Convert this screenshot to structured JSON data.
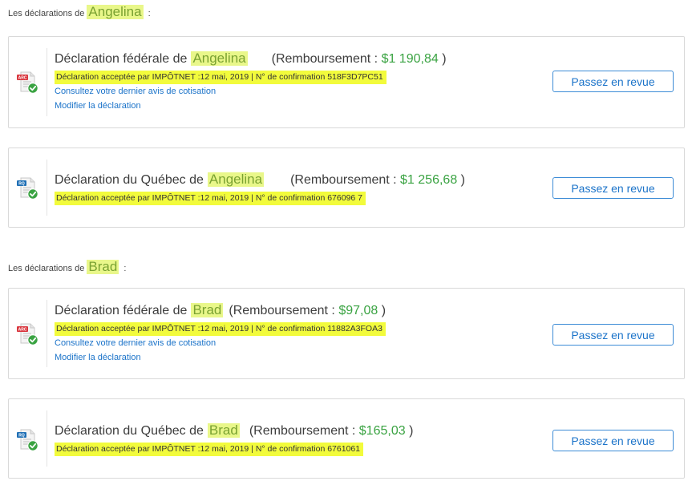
{
  "sections": [
    {
      "prefix": "Les déclarations de",
      "name": "Angelina",
      "suffix": ":",
      "returns": [
        {
          "title": "Déclaration fédérale de",
          "name": "Angelina",
          "refund_prefix": "(Remboursement :",
          "amount": "$1 190,84",
          "refund_suffix": ")",
          "badge": "ARC",
          "status": "Déclaration acceptée par IMPÔTNET :12 mai, 2019 | N° de confirmation 518F3D7PC51",
          "links": [
            "Consultez votre dernier avis de cotisation",
            "Modifier la déclaration"
          ],
          "button": "Passez en revue"
        },
        {
          "title": "Déclaration du Québec de",
          "name": "Angelina",
          "refund_prefix": "(Remboursement :",
          "amount": "$1 256,68",
          "refund_suffix": ")",
          "badge": "RQ",
          "status": "Déclaration acceptée par IMPÔTNET :12 mai, 2019 | N° de confirmation 676096 7",
          "button": "Passez en revue"
        }
      ]
    },
    {
      "prefix": "Les déclarations de",
      "name": "Brad",
      "suffix": ":",
      "returns": [
        {
          "title": "Déclaration fédérale de",
          "name": "Brad",
          "refund_prefix": "(Remboursement :",
          "amount": "$97,08",
          "refund_suffix": ")",
          "badge": "ARC",
          "status": "Déclaration acceptée par IMPÔTNET :12 mai, 2019 | N° de confirmation 11882A3FOA3",
          "links": [
            "Consultez votre dernier avis de cotisation",
            "Modifier la déclaration"
          ],
          "button": "Passez en revue"
        },
        {
          "title": "Déclaration du Québec de",
          "name": "Brad",
          "refund_prefix": "(Remboursement :",
          "amount": "$165,03",
          "refund_suffix": ")",
          "badge": "RQ",
          "status": "Déclaration acceptée par IMPÔTNET :12 mai, 2019 | N° de confirmation 6761061",
          "button": "Passez en revue"
        }
      ]
    }
  ],
  "colors": {
    "highlight_name": "#e9f78a",
    "highlight_status": "#f2fb3c",
    "name_text": "#7aa232",
    "amount": "#3aa342",
    "link": "#1b73c9",
    "arc_badge": "#d9363e",
    "rq_badge": "#1f6fb5",
    "check": "#3aa342"
  },
  "icons": {
    "federal": "arc-document-check-icon",
    "quebec": "rq-document-check-icon"
  }
}
